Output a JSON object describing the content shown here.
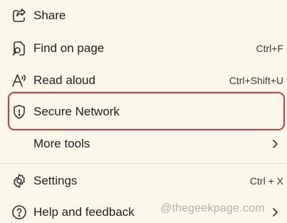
{
  "menu": {
    "share": {
      "label": "Share",
      "icon": "share-icon"
    },
    "find": {
      "label": "Find on page",
      "shortcut": "Ctrl+F",
      "icon": "find-on-page-icon"
    },
    "read": {
      "label": "Read aloud",
      "shortcut": "Ctrl+Shift+U",
      "icon": "read-aloud-icon"
    },
    "secure": {
      "label": "Secure Network",
      "icon": "shield-icon",
      "highlighted": true
    },
    "more": {
      "label": "More tools",
      "icon": "chevron-right-icon"
    },
    "settings": {
      "label": "Settings",
      "shortcut": "Ctrl + X",
      "icon": "gear-icon"
    },
    "help": {
      "label": "Help and feedback",
      "icon": "question-icon"
    }
  },
  "watermark": "@thegeekpage.com",
  "colors": {
    "background": "#fbf8eb",
    "highlight_border": "#d9363e",
    "text": "#1f1f1f"
  }
}
